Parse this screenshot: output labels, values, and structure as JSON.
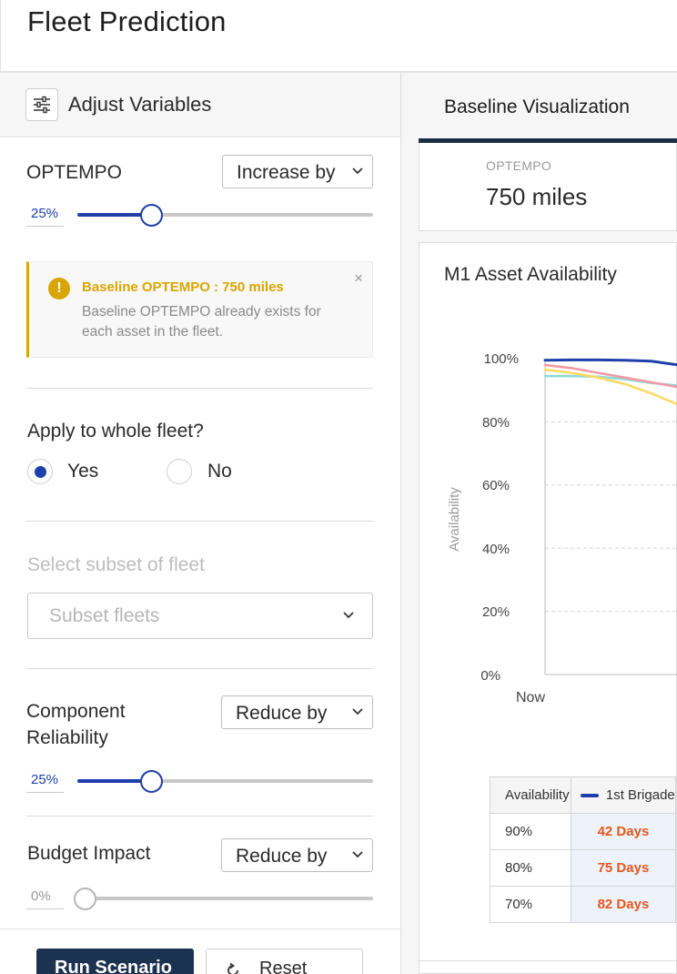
{
  "header": {
    "title": "Fleet Prediction"
  },
  "left": {
    "title": "Adjust Variables",
    "optempo": {
      "label": "OPTEMPO",
      "mode": "Increase by",
      "percent_label": "25%",
      "percent": 25,
      "alert_title": "Baseline OPTEMPO : 750 miles",
      "alert_body": "Baseline OPTEMPO already exists for each asset in the fleet.",
      "alert_close": "×"
    },
    "apply": {
      "question": "Apply to whole fleet?",
      "yes": "Yes",
      "no": "No",
      "selected": "Yes"
    },
    "subset": {
      "label": "Select subset of fleet",
      "placeholder": "Subset fleets"
    },
    "reliability": {
      "label_line1": "Component",
      "label_line2": "Reliability",
      "mode": "Reduce by",
      "percent_label": "25%",
      "percent": 25
    },
    "budget": {
      "label": "Budget Impact",
      "mode": "Reduce by",
      "percent_label": "0%",
      "percent": 0
    },
    "buttons": {
      "run": "Run Scenario",
      "reset": "Reset"
    }
  },
  "right": {
    "tab": "Baseline Visualization",
    "metric": {
      "key": "OPTEMPO",
      "value": "750 miles"
    },
    "chart_title": "M1 Asset Availability",
    "table": {
      "header_key": "Availability",
      "header_series": "1st Brigade",
      "rows": [
        {
          "k": "90%",
          "v": "42 Days"
        },
        {
          "k": "80%",
          "v": "75 Days"
        },
        {
          "k": "70%",
          "v": "82 Days"
        }
      ]
    }
  },
  "chart_data": {
    "type": "line",
    "title": "M1 Asset Availability",
    "ylabel": "Availability",
    "xlabel": "",
    "x_ticks": [
      "Now"
    ],
    "y_ticks": [
      "100%",
      "80%",
      "60%",
      "40%",
      "20%",
      "0%"
    ],
    "ylim": [
      0,
      100
    ],
    "grid": true,
    "series": [
      {
        "color": "#1f3faa",
        "values": [
          99.5,
          99.6,
          99.6,
          99.5,
          99.2,
          98.0
        ]
      },
      {
        "color": "#f29aa8",
        "values": [
          98.0,
          97.0,
          95.5,
          94.0,
          92.5,
          91.0
        ]
      },
      {
        "color": "#ffd966",
        "values": [
          96.5,
          95.5,
          94.0,
          92.0,
          89.0,
          85.5
        ]
      },
      {
        "color": "#8fd9d9",
        "values": [
          94.5,
          94.5,
          94.3,
          93.5,
          92.3,
          91.5
        ]
      }
    ]
  },
  "colors": {
    "accent": "#1f3faa",
    "primary_button": "#1b3350",
    "warning": "#d9a500",
    "days": "#e8561a"
  }
}
